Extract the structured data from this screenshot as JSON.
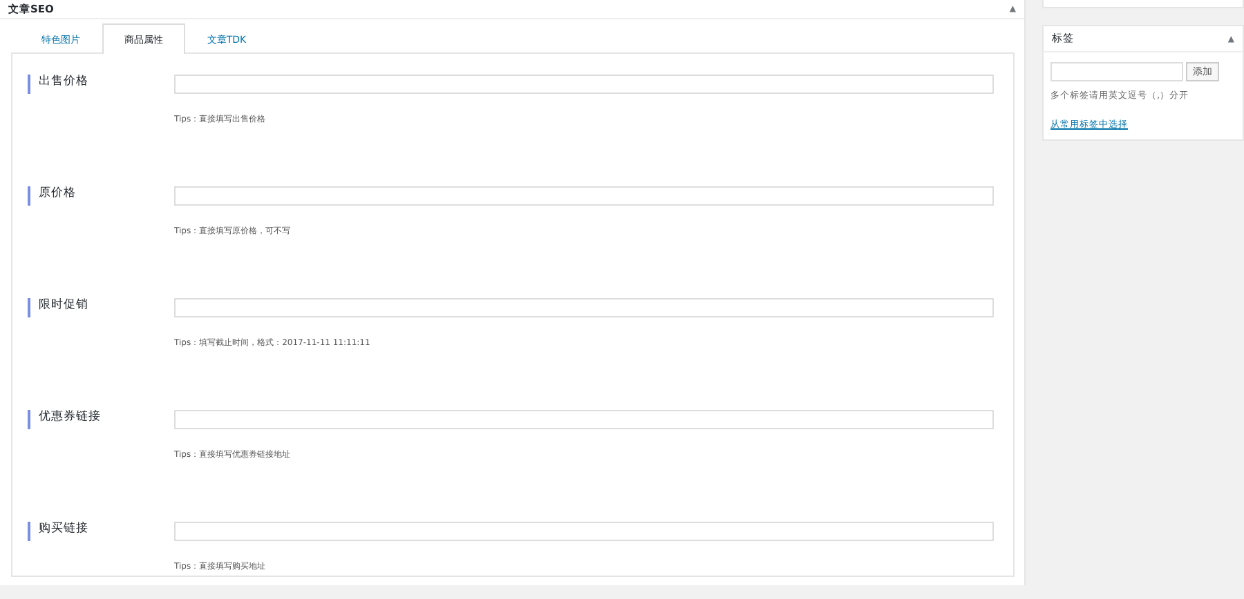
{
  "main_box": {
    "title": "文章SEO",
    "toggle": "▲"
  },
  "tabs": [
    {
      "label": "特色图片",
      "selected": false
    },
    {
      "label": "商品属性",
      "selected": true
    },
    {
      "label": "文章TDK",
      "selected": false
    }
  ],
  "fields": [
    {
      "label": "出售价格",
      "tip": "Tips：直接填写出售价格"
    },
    {
      "label": "原价格",
      "tip": "Tips：直接填写原价格，可不写"
    },
    {
      "label": "限时促销",
      "tip": "Tips：填写截止时间，格式：2017-11-11 11:11:11"
    },
    {
      "label": "优惠券链接",
      "tip": "Tips：直接填写优惠券链接地址"
    },
    {
      "label": "购买链接",
      "tip": "Tips：直接填写购买地址"
    }
  ],
  "tags_box": {
    "title": "标签",
    "toggle": "▲",
    "add_button": "添加",
    "hint": "多个标签请用英文逗号（,）分开",
    "link": "从常用标签中选择"
  }
}
